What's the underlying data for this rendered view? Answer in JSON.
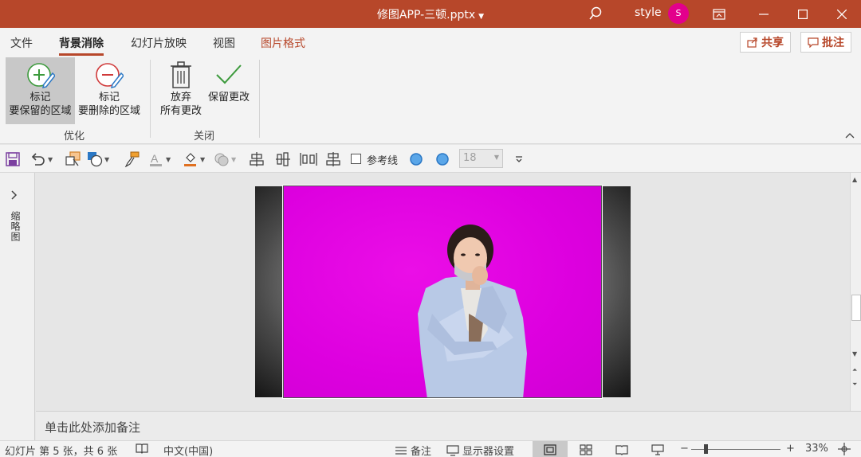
{
  "window": {
    "title": "修图APP-三顿.pptx",
    "user_name": "style",
    "avatar_initial": "S"
  },
  "tabs": {
    "file": "文件",
    "background_removal": "背景消除",
    "slideshow": "幻灯片放映",
    "view": "视图",
    "picture_format": "图片格式",
    "active": "背景消除"
  },
  "actions": {
    "share": "共享",
    "comments": "批注"
  },
  "ribbon": {
    "mark_keep_line1": "标记",
    "mark_keep_line2": "要保留的区域",
    "mark_remove_line1": "标记",
    "mark_remove_line2": "要删除的区域",
    "discard_line1": "放弃",
    "discard_line2": "所有更改",
    "keep_changes": "保留更改",
    "group_refine": "优化",
    "group_close": "关闭"
  },
  "quick_access": {
    "guides_label": "参考线",
    "font_size_value": "18"
  },
  "thumbnail_pane": {
    "label": "缩略图"
  },
  "notes": {
    "placeholder": "单击此处添加备注"
  },
  "status_bar": {
    "slide_info": "幻灯片 第 5 张，共 6 张",
    "language": "中文(中国)",
    "notes_label": "备注",
    "display_settings": "显示器设置",
    "zoom_minus": "−",
    "zoom_plus": "+",
    "zoom_level": "33%"
  },
  "colors": {
    "brand": "#b7472a",
    "removal_overlay": "#dd00df",
    "avatar": "#e3008c"
  }
}
